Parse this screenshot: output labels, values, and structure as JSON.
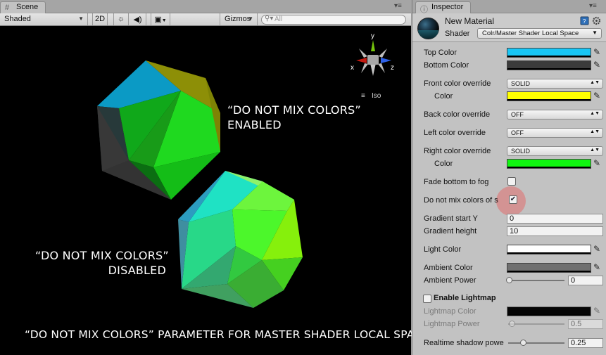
{
  "scene": {
    "tab_label": "Scene",
    "shading_mode": "Shaded",
    "btn_2d": "2D",
    "gizmos_label": "Gizmos",
    "search_placeholder": "All",
    "iso_label": "Iso",
    "axis_x": "x",
    "axis_y": "y",
    "axis_z": "z"
  },
  "annotations": {
    "enabled_line1": "“DO NOT MIX COLORS”",
    "enabled_line2": "ENABLED",
    "disabled_line1": "“DO NOT MIX COLORS”",
    "disabled_line2": "DISABLED",
    "caption": "“DO NOT MIX COLORS” PARAMETER FOR MASTER SHADER LOCAL SPACE"
  },
  "inspector": {
    "tab_label": "Inspector",
    "material_name": "New Material",
    "shader_label": "Shader",
    "shader_value": "Colr/Master Shader Local Space",
    "properties": {
      "top_color": {
        "label": "Top Color",
        "color": "#19c6f5"
      },
      "bottom_color": {
        "label": "Bottom Color",
        "color": "#3b3b3b"
      },
      "front_override": {
        "label": "Front color override",
        "value": "SOLID"
      },
      "front_color": {
        "label": "Color",
        "color": "#ffff00"
      },
      "back_override": {
        "label": "Back color override",
        "value": "OFF"
      },
      "left_override": {
        "label": "Left color override",
        "value": "OFF"
      },
      "right_override": {
        "label": "Right color override",
        "value": "SOLID"
      },
      "right_color": {
        "label": "Color",
        "color": "#11f511"
      },
      "fade_bottom": {
        "label": "Fade bottom to fog",
        "checked": false
      },
      "no_mix": {
        "label": "Do not mix colors of s",
        "checked": true,
        "check_glyph": "✔"
      },
      "gradient_start": {
        "label": "Gradient start Y",
        "value": "0"
      },
      "gradient_height": {
        "label": "Gradient height",
        "value": "10"
      },
      "light_color": {
        "label": "Light Color",
        "color": "#ffffff"
      },
      "ambient_color": {
        "label": "Ambient Color",
        "color": "#707070"
      },
      "ambient_power": {
        "label": "Ambient Power",
        "value": "0",
        "level": 0
      },
      "enable_lightmap": {
        "label": "Enable Lightmap",
        "checked": false
      },
      "lightmap_color": {
        "label": "Lightmap Color",
        "color": "#050505"
      },
      "lightmap_power": {
        "label": "Lightmap Power",
        "value": "0.5",
        "level": 0.05
      },
      "shadow_power": {
        "label": "Realtime shadow powe",
        "value": "0.25",
        "level": 0.25
      }
    }
  },
  "icons": {
    "scene_tab": "grid-icon",
    "inspector_tab": "info-icon",
    "lighting_toggle": "sun-icon",
    "audio_toggle": "speaker-icon",
    "effects_toggle": "image-icon",
    "eyedropper": "eyedropper-icon",
    "help": "book-icon",
    "settings": "gear-icon"
  }
}
